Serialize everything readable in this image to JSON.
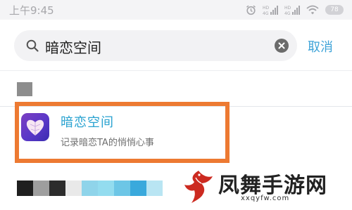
{
  "status_bar": {
    "time": "上午9:45",
    "battery": "78",
    "icons": [
      "alarm-icon",
      "signal-4g-hd-icon",
      "signal-4g-hd-icon",
      "wifi-icon",
      "battery-icon"
    ]
  },
  "search": {
    "query": "暗恋空间",
    "cancel_label": "取消",
    "icons": [
      "search-icon",
      "clear-icon"
    ]
  },
  "result": {
    "title": "暗恋空间",
    "description": "记录暗恋TA的悄悄心事",
    "icon": "app-heart-icon"
  },
  "highlight_color": "#ED7A32",
  "palette": [
    "#1f1f1f",
    "#9e9e9e",
    "#2c2c2c",
    "#e9e9e9",
    "#8fd4ea",
    "#93dcef",
    "#6dc6e6",
    "#3aa9dc",
    "#b9e5f3"
  ],
  "watermark": {
    "title": "凤舞手游网",
    "domain": "xxqyfw.com",
    "logo": "phoenix-logo"
  },
  "colors": {
    "accent": "#3EA3D8",
    "result_title": "#28A2D0"
  }
}
